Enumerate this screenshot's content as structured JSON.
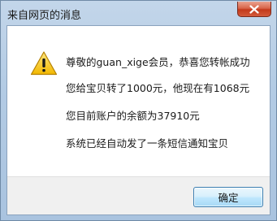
{
  "dialog": {
    "title": "来自网页的消息",
    "icon": "warning-icon",
    "messages": [
      "尊敬的guan_xige会员，恭喜您转帐成功",
      "您给宝贝转了1000元，他现在有1068元",
      "您目前账户的余额为37910元",
      "系统已经自动发了一条短信通知宝贝"
    ],
    "ok_label": "确定"
  },
  "colors": {
    "close_button": "#c3391b",
    "warning_fill": "#f5c400",
    "frame": "#b3cbe4"
  }
}
